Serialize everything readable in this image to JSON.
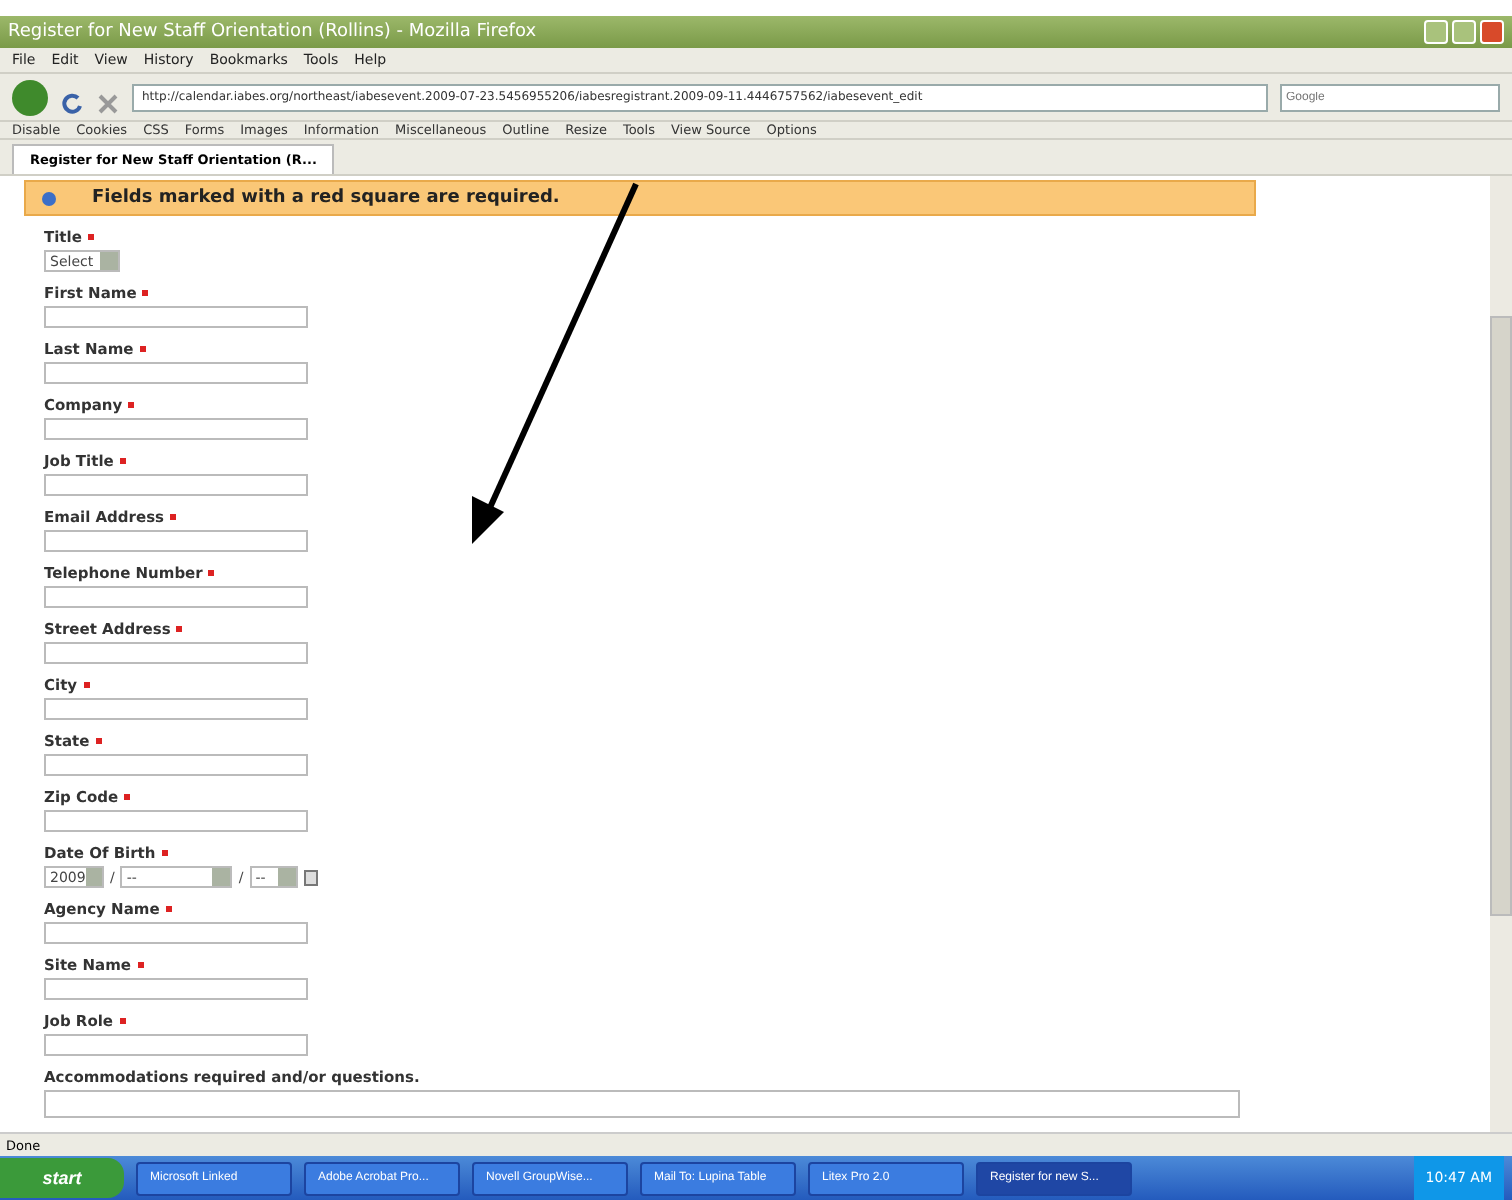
{
  "window": {
    "title": "Register for New Staff Orientation (Rollins) - Mozilla Firefox"
  },
  "menu": [
    "File",
    "Edit",
    "View",
    "History",
    "Bookmarks",
    "Tools",
    "Help"
  ],
  "address": {
    "url": "http://calendar.iabes.org/northeast/iabesevent.2009-07-23.5456955206/iabesregistrant.2009-09-11.4446757562/iabesevent_edit"
  },
  "search": {
    "placeholder": "Google"
  },
  "dev_toolbar": [
    "Disable",
    "Cookies",
    "CSS",
    "Forms",
    "Images",
    "Information",
    "Miscellaneous",
    "Outline",
    "Resize",
    "Tools",
    "View Source",
    "Options"
  ],
  "tabs": [
    {
      "label": "Register for New Staff Orientation (R...",
      "selected": true
    }
  ],
  "notice": "Fields marked with a red square are required.",
  "fields": [
    {
      "kind": "select",
      "label": "Title",
      "required": true,
      "value": "Select"
    },
    {
      "kind": "text",
      "label": "First Name",
      "required": true
    },
    {
      "kind": "text",
      "label": "Last Name",
      "required": true
    },
    {
      "kind": "text",
      "label": "Company",
      "required": true
    },
    {
      "kind": "text",
      "label": "Job Title",
      "required": true
    },
    {
      "kind": "text",
      "label": "Email Address",
      "required": true
    },
    {
      "kind": "text",
      "label": "Telephone Number",
      "required": true
    },
    {
      "kind": "text",
      "label": "Street Address",
      "required": true
    },
    {
      "kind": "text",
      "label": "City",
      "required": true
    },
    {
      "kind": "text",
      "label": "State",
      "required": true
    },
    {
      "kind": "text",
      "label": "Zip Code",
      "required": true
    },
    {
      "kind": "date",
      "label": "Date Of Birth",
      "required": true,
      "parts": [
        "2009",
        "--",
        "--"
      ],
      "separators": [
        "/",
        "/"
      ]
    },
    {
      "kind": "text",
      "label": "Agency Name",
      "required": true
    },
    {
      "kind": "text",
      "label": "Site Name",
      "required": true
    },
    {
      "kind": "text",
      "label": "Job Role",
      "required": true
    },
    {
      "kind": "textarea",
      "label": "Accommodations required and/or questions.",
      "required": false
    }
  ],
  "status_bar": "Done",
  "taskbar": {
    "start": "start",
    "items": [
      {
        "label": "Microsoft Linked",
        "selected": false
      },
      {
        "label": "Adobe Acrobat Pro...",
        "selected": false
      },
      {
        "label": "Novell GroupWise...",
        "selected": false
      },
      {
        "label": "Mail To: Lupina Table",
        "selected": false
      },
      {
        "label": "Litex Pro 2.0",
        "selected": false
      },
      {
        "label": "Register for new S...",
        "selected": true
      }
    ],
    "clock": "10:47 AM"
  }
}
